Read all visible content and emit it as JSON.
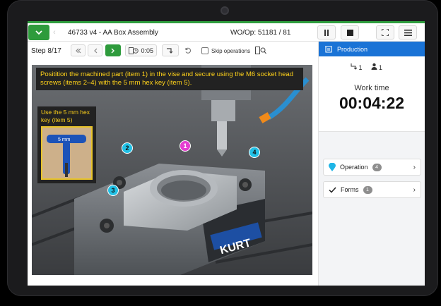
{
  "header": {
    "title": "46733 v4 - AA Box Assembly",
    "wo_op": "WO/Op: 51181 / 81"
  },
  "stepbar": {
    "step": "Step 8/17",
    "timer": "0:05",
    "skip_label": "Skip operations"
  },
  "instruction": "Positition the machined part (item 1) in the vise and secure using the M6 socket head screws (items 2–4) with the 5 mm hex key (item 5).",
  "hex_card": {
    "text": "Use the 5 mm hex key (item 5)",
    "tool_label": "5 mm"
  },
  "markers": [
    "1",
    "2",
    "3",
    "4"
  ],
  "vise_brand": "KURT",
  "sidebar": {
    "header": "Production",
    "count_a": "1",
    "count_b": "1",
    "work_time_label": "Work time",
    "work_time": "00:04:22",
    "operation_label": "Operation",
    "operation_count": "4",
    "forms_label": "Forms",
    "forms_count": "1"
  },
  "colors": {
    "green": "#2e9b3c",
    "blue": "#1a73d6",
    "instruction_text": "#ffd21a",
    "marker_cyan": "#22c1e6",
    "marker_magenta": "#e53fd1"
  },
  "icons": [
    "chevron-down-icon",
    "pause-icon",
    "stop-icon",
    "fullscreen-icon",
    "menu-icon",
    "first-step-icon",
    "prev-step-icon",
    "next-step-icon",
    "doc-clock-icon",
    "redirect-icon",
    "undo-icon",
    "doc-zoom-icon",
    "production-icon",
    "operator-icon",
    "person-icon",
    "location-pin-icon",
    "check-icon",
    "chevron-right-icon"
  ]
}
